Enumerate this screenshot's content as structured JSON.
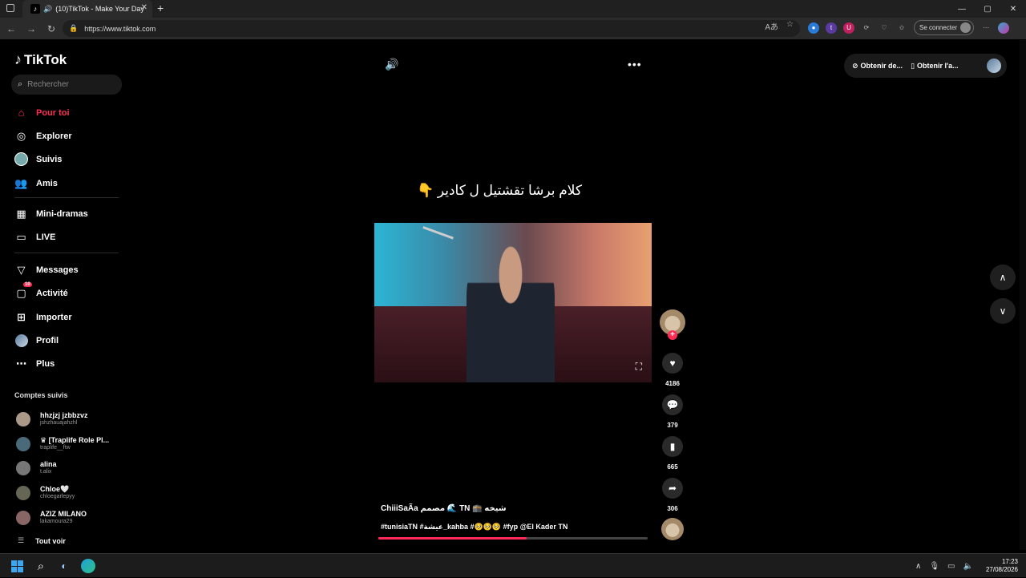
{
  "browser": {
    "tab_title": "(10)TikTok - Make Your Day",
    "url": "https://www.tiktok.com",
    "signin_label": "Se connecter",
    "tab_close": "✕",
    "new_tab": "+",
    "window_controls": [
      "—",
      "▢",
      "✕"
    ]
  },
  "brand": {
    "name": "TikTok",
    "accent": "#fe2c55"
  },
  "search": {
    "placeholder": "Rechercher"
  },
  "nav": [
    {
      "label": "Pour toi",
      "icon": "home-icon",
      "active": true
    },
    {
      "label": "Explorer",
      "icon": "compass-icon"
    },
    {
      "label": "Suivis",
      "icon": "following-avatar-icon"
    },
    {
      "label": "Amis",
      "icon": "friends-icon"
    },
    {
      "label": "Mini-dramas",
      "icon": "film-icon"
    },
    {
      "label": "LIVE",
      "icon": "tv-icon"
    },
    {
      "label": "Messages",
      "icon": "send-icon"
    },
    {
      "label": "Activité",
      "icon": "inbox-icon",
      "badge": "10"
    },
    {
      "label": "Importer",
      "icon": "upload-plus-icon"
    },
    {
      "label": "Profil",
      "icon": "profile-avatar-icon"
    },
    {
      "label": "Plus",
      "icon": "more-dots-icon"
    }
  ],
  "followed": {
    "title": "Comptes suivis",
    "accounts": [
      {
        "name": "hhzjzj jzbbzvz",
        "handle": "jshzhauajahzhl"
      },
      {
        "name": "♛ [Traplife Role Pl...",
        "handle": "traplife__ftw"
      },
      {
        "name": "alina",
        "handle": "t.alix"
      },
      {
        "name": "Chloe🤍",
        "handle": "chloegarlepyy"
      },
      {
        "name": "AZIZ MILANO",
        "handle": "lakamoura29"
      }
    ],
    "see_all": "Tout voir"
  },
  "topbar": {
    "coins_label": "Obtenir de...",
    "app_label": "Obtenir l'a..."
  },
  "video": {
    "caption_overlay": "كلام برشا تقشتيل ل كادير 👇",
    "author_line": "ChiiiSaÃa مصمم 🌊 TN 🕋 شيخه",
    "tags_line": "#tunisiaTN #عيشة_kahba #🥺🥺🥺 #fyp @El Kader TN",
    "progress": 0.55
  },
  "actions": {
    "likes": "4186",
    "comments": "379",
    "saves": "665",
    "shares": "306"
  },
  "taskbar": {
    "time": "17:23",
    "date": "27/08/2026"
  }
}
